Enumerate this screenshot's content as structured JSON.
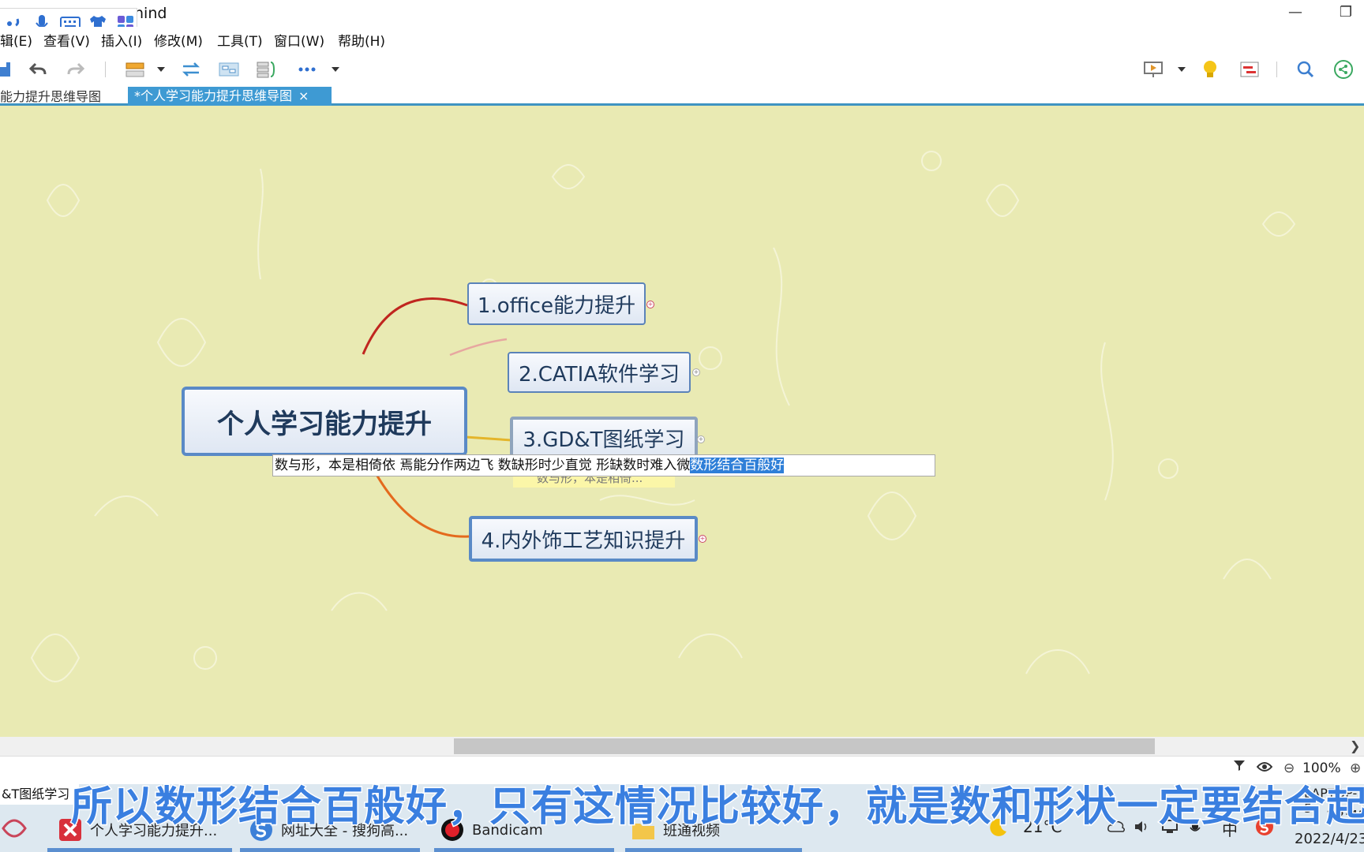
{
  "window": {
    "title": "nind",
    "minimize_icon": "minimize-icon",
    "restore_icon": "restore-icon"
  },
  "menu": [
    "辑(E)",
    "查看(V)",
    "插入(I)",
    "修改(M)",
    "工具(T)",
    "窗口(W)",
    "帮助(H)"
  ],
  "tabs": {
    "tab1": "能力提升思维导图",
    "tab2": "*个人学习能力提升思维导图",
    "close_glyph": "×"
  },
  "mindmap": {
    "root": "个人学习能力提升",
    "branches": [
      {
        "label": "1.office能力提升",
        "color": "#c0261f"
      },
      {
        "label": "2.CATIA软件学习",
        "color": "#e7a7a0"
      },
      {
        "label": "3.GD&T图纸学习",
        "color": "#e4b52a"
      },
      {
        "label": "4.内外饰工艺知识提升",
        "color": "#e46a1d"
      }
    ],
    "expand_glyph": "+"
  },
  "editor": {
    "text_before": "数与形，本是相倚依  焉能分作两边飞  数缺形时少直觉 形缺数时难入微",
    "text_selected": "数形结合百般好",
    "note_text": "数与形，本是相倚..."
  },
  "statusbar": {
    "zoom": "100%",
    "left_text": "&T图纸学习"
  },
  "taskbar": {
    "items": [
      {
        "label": "个人学习能力提升...",
        "icon": "xmind-icon"
      },
      {
        "label": "网址大全 - 搜狗高...",
        "icon": "sogou-browser-icon"
      },
      {
        "label": "Bandicam",
        "icon": "bandicam-record-icon"
      },
      {
        "label": "班通视频",
        "icon": "folder-icon"
      }
    ],
    "weather": "21°C",
    "host": "LAPTOP-5",
    "time": "22:42",
    "date": "2022/4/23",
    "ime_indicator": "中"
  },
  "subtitle": "所以数形结合百般好，只有这情况比较好，就是数和形状一定要结合起来",
  "colors": {
    "canvas_bg": "#e9eab3",
    "tab_active": "#3e9ad3",
    "node_border": "#5b83b9"
  }
}
